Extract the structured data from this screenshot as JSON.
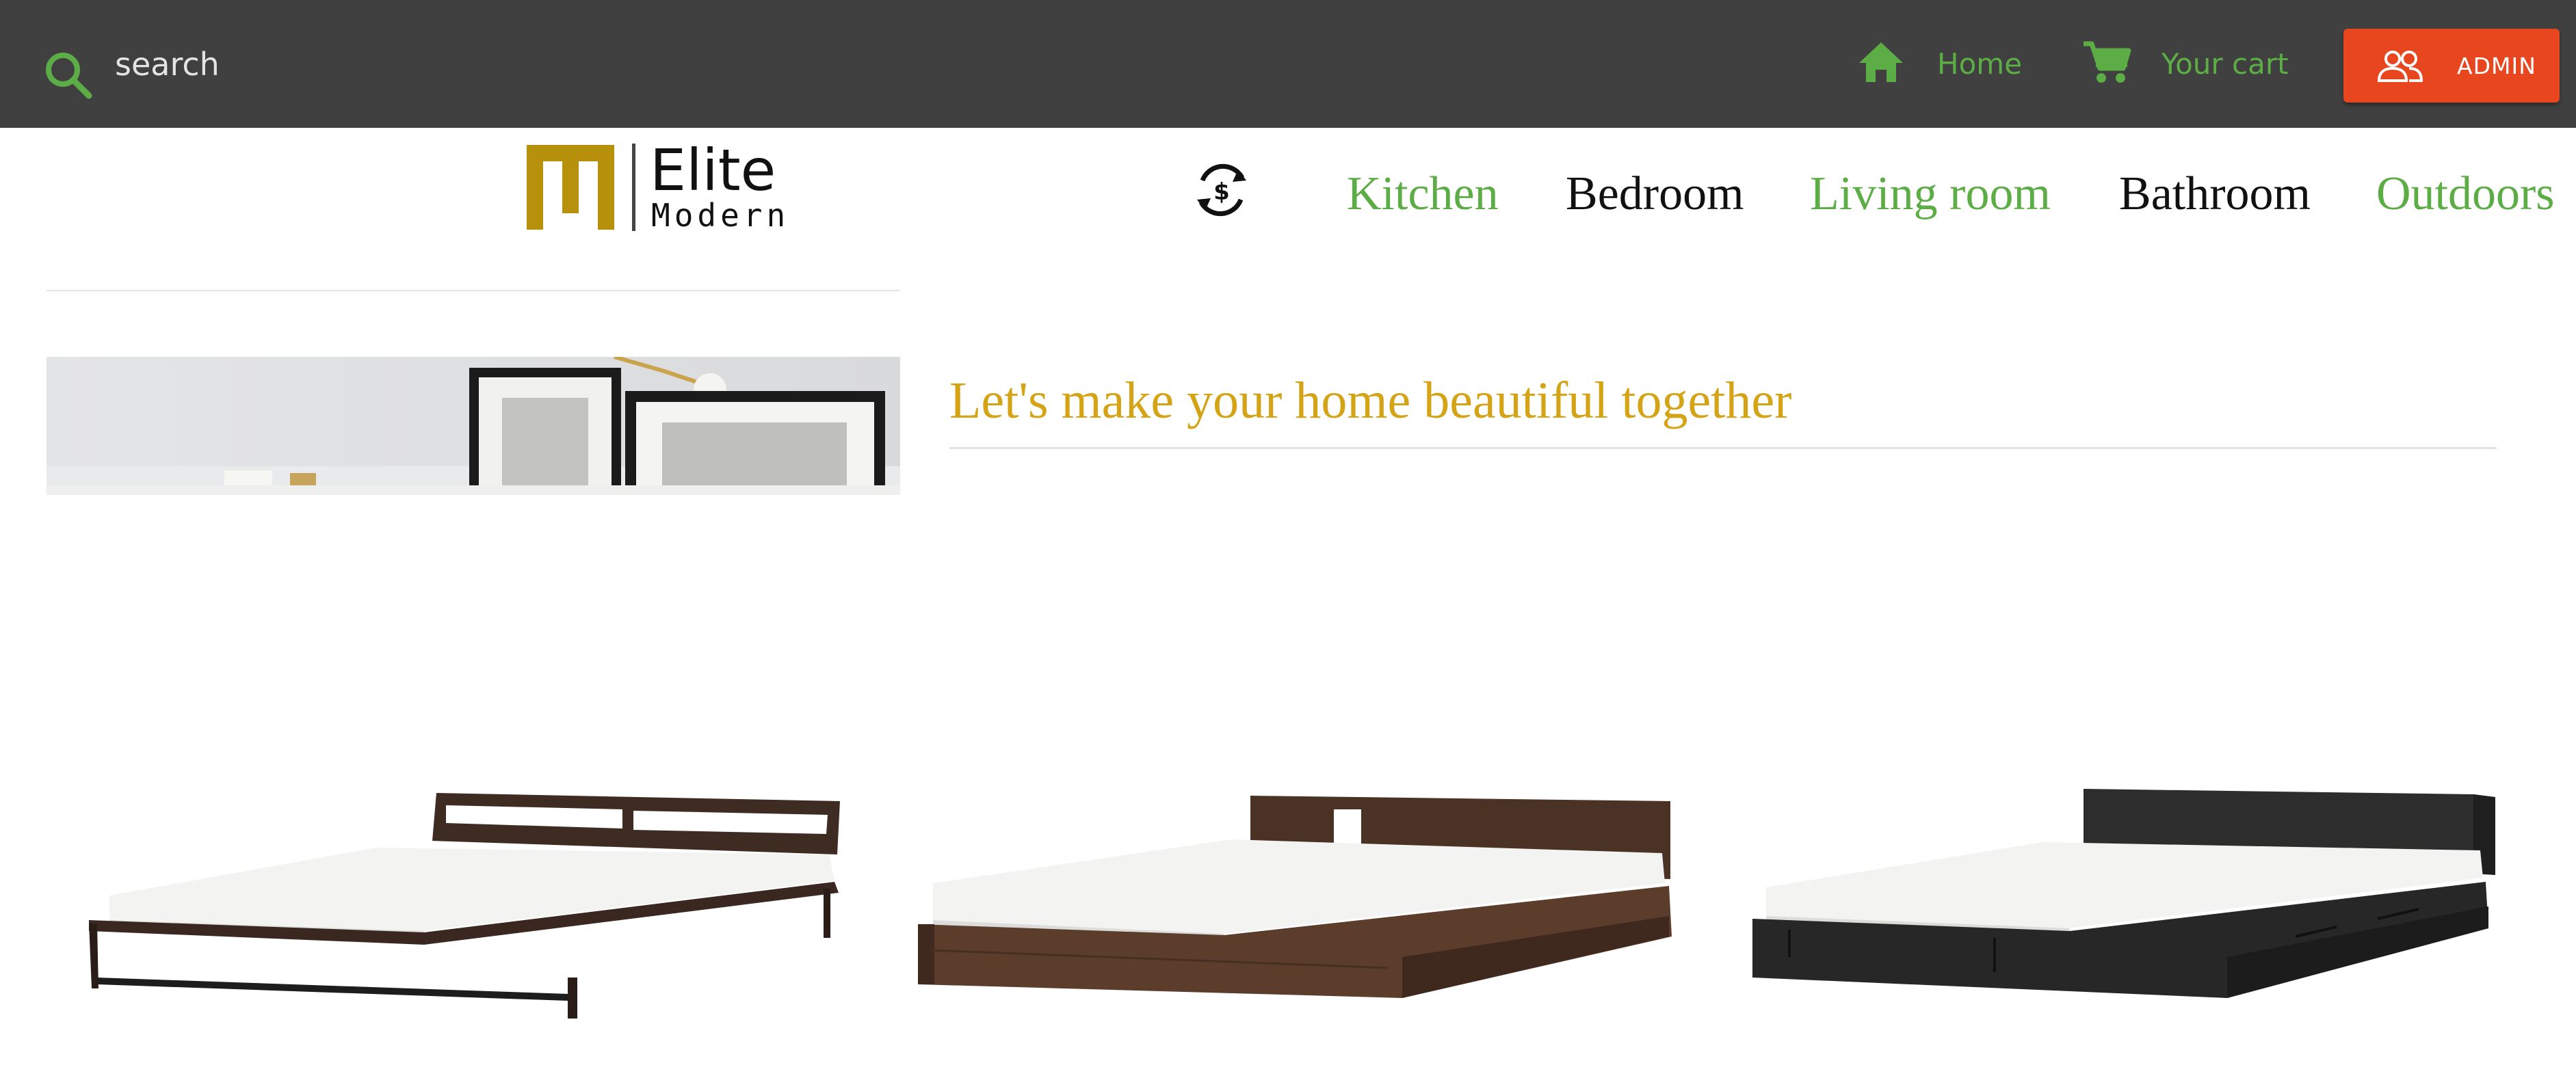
{
  "topbar": {
    "search": {
      "placeholder": "search",
      "icon": "search-icon"
    },
    "home": {
      "label": "Home",
      "icon": "home-icon"
    },
    "cart": {
      "label": "Your cart",
      "icon": "cart-icon"
    },
    "admin": {
      "label": "ADMIN",
      "icon": "users-icon"
    },
    "colors": {
      "bar": "#404040",
      "link": "#5cad45",
      "admin": "#e8461e"
    }
  },
  "logo": {
    "word1": "Elite",
    "word2": "Modern",
    "color": "#b8910c"
  },
  "currency": {
    "icon": "currency-exchange-icon"
  },
  "categories": [
    {
      "label": "Kitchen"
    },
    {
      "label": "Bedroom"
    },
    {
      "label": "Living room"
    },
    {
      "label": "Bathroom"
    },
    {
      "label": "Outdoors"
    }
  ],
  "banner": {
    "tagline": "Let's make your home beautiful together",
    "tagline_color": "#d5a316"
  },
  "products": [
    {
      "name": "bed-dark-frame-open-headboard"
    },
    {
      "name": "bed-walnut-low-platform"
    },
    {
      "name": "bed-black-storage-platform"
    }
  ]
}
